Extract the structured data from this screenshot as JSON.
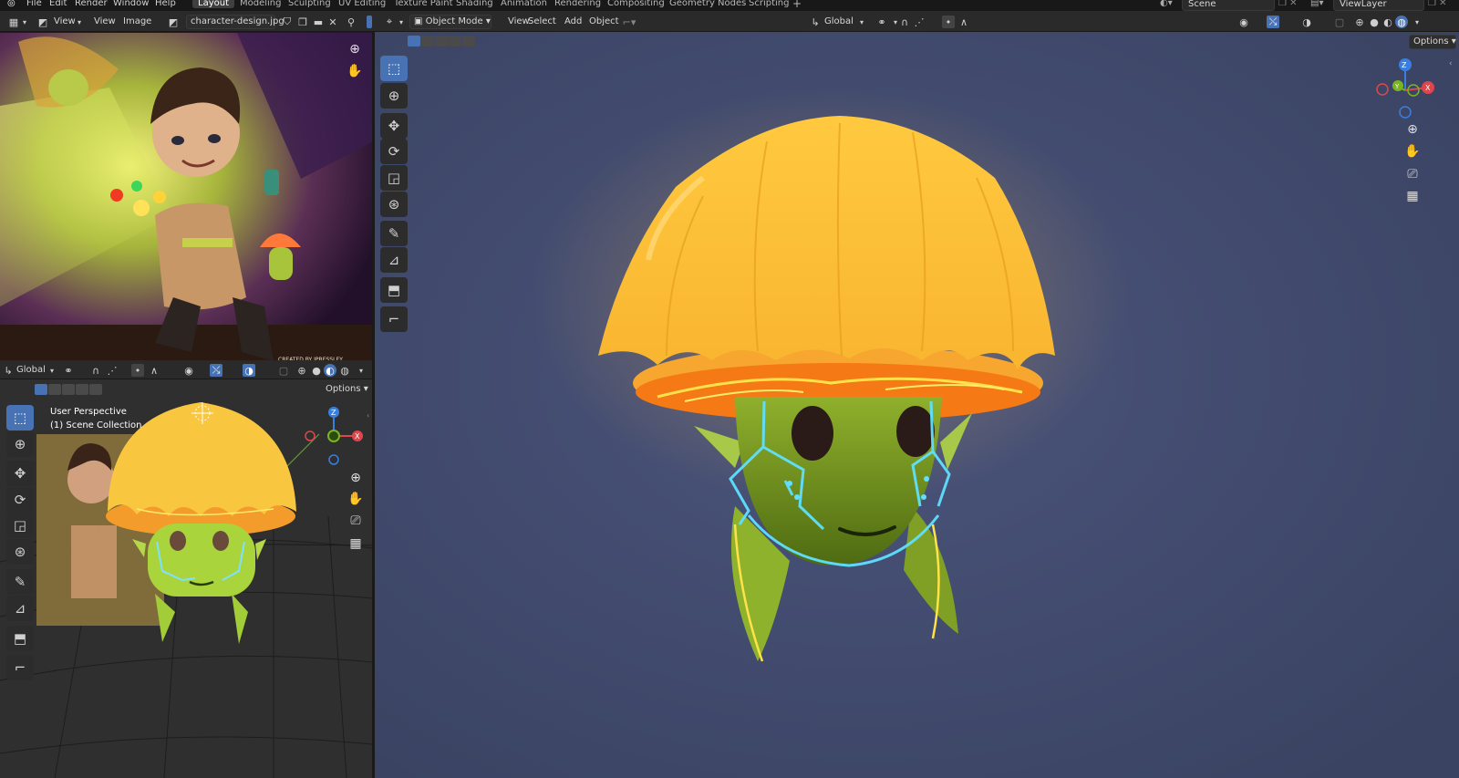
{
  "topbar": {
    "menus": [
      "File",
      "Edit",
      "Render",
      "Window",
      "Help"
    ],
    "workspaces": [
      "Layout",
      "Modeling",
      "Sculpting",
      "UV Editing",
      "Texture Paint",
      "Shading",
      "Animation",
      "Rendering",
      "Compositing",
      "Geometry Nodes",
      "Scripting"
    ],
    "add_tab": "+",
    "scene": "Scene",
    "view_layer": "ViewLayer"
  },
  "image_editor": {
    "view_menu": "View",
    "view2_menu": "View",
    "image_menu": "Image",
    "image_name": "character-design.jpg",
    "watermark": "CREATED BY JPRESSLEY"
  },
  "small_viewport": {
    "orientation": "Global",
    "options": "Options",
    "overlay_title": "User Perspective",
    "overlay_collection": "(1) Scene Collection"
  },
  "main_viewport": {
    "mode": "Object Mode",
    "menus": [
      "View",
      "Select",
      "Add",
      "Object"
    ],
    "orientation": "Global",
    "options": "Options"
  },
  "gizmo": {
    "x": "X",
    "y": "Y",
    "z": "Z"
  },
  "colors": {
    "viewport_bg": "#414a6b",
    "accent": "#4772b3",
    "x_axis": "#e0454c",
    "y_axis": "#7ab51d",
    "z_axis": "#3a7fe0"
  }
}
